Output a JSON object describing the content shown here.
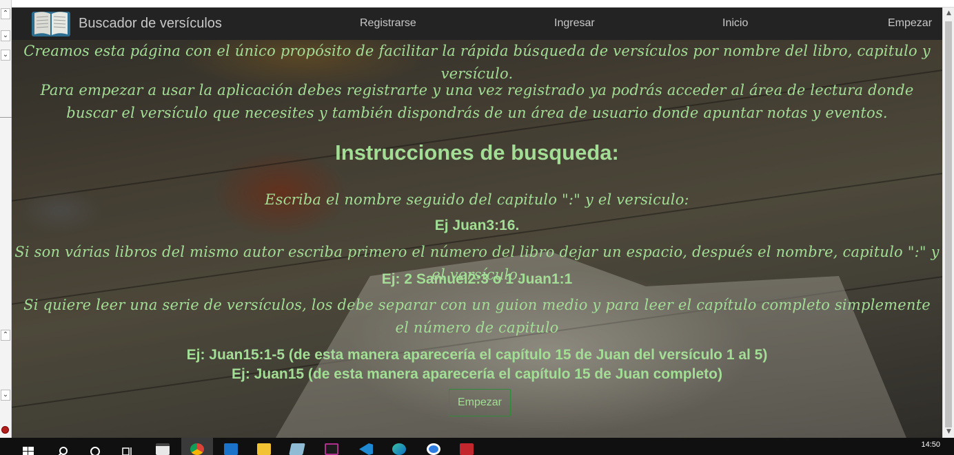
{
  "window": {
    "title": "Buscador de versículos"
  },
  "nav": {
    "brand": "Buscador de versículos",
    "links": [
      "Registrarse",
      "Ingresar",
      "Inicio",
      "Empezar"
    ]
  },
  "content": {
    "intro": "Creamos esta página con el único propósito de facilitar la rápida búsqueda de versículos por nombre del libro, capitulo y versículo.",
    "usage": "Para empezar a usar la aplicación debes registrarte y una vez registrado ya podrás acceder al área de lectura donde buscar el versículo que necesites y también dispondrás de un área de usuario donde apuntar notas y eventos.",
    "heading": "Instrucciones de busqueda:",
    "instr1": "Escriba el nombre seguido del capitulo \":\" y el versiculo:",
    "example1": "Ej Juan3:16.",
    "instr2": "Si son várias libros del mismo autor escriba primero el número del libro dejar un espacio, después el nombre, capitulo \":\" y el versículo.",
    "example2": "Ej: 2 Samuel2:3 o 1 Juan1:1",
    "instr3": "Si quiere leer una serie de versículos, los debe separar con un guion medio y para leer el capítulo completo simplemente el número de capitulo",
    "example3": "Ej: Juan15:1-5 (de esta manera aparecería el capítulo 15 de Juan del versículo 1 al 5)",
    "example4": "Ej: Juan15 (de esta manera aparecería el capítulo 15 de Juan completo)",
    "start_button": "Empezar"
  },
  "taskbar": {
    "apps": [
      "windows-start",
      "search",
      "cortana",
      "task-view",
      "store",
      "chrome",
      "mail",
      "file-explorer",
      "notepad",
      "intellij",
      "vscode",
      "edge",
      "app-blue",
      "filezilla"
    ],
    "time": "14:50"
  },
  "colors": {
    "accent_text": "#a3dd96",
    "nav_bg": "#232323",
    "button_border": "#2e8b3a"
  }
}
